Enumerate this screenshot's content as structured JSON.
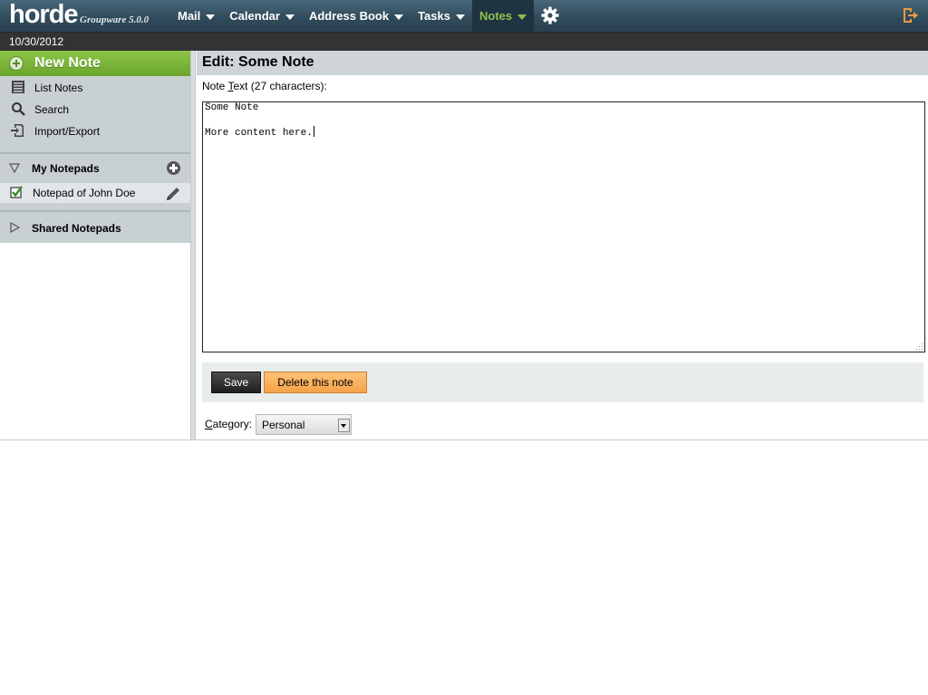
{
  "header": {
    "logo_text": "horde",
    "logo_sub": "Groupware 5.0.0",
    "menu": [
      {
        "label": "Mail",
        "active": false
      },
      {
        "label": "Calendar",
        "active": false
      },
      {
        "label": "Address Book",
        "active": false
      },
      {
        "label": "Tasks",
        "active": false
      },
      {
        "label": "Notes",
        "active": true
      }
    ],
    "accent_color": "#8bc34a"
  },
  "date": "10/30/2012",
  "sidebar": {
    "new_note": "New Note",
    "nav": [
      {
        "label": "List Notes",
        "icon": "list-notes-icon"
      },
      {
        "label": "Search",
        "icon": "search-icon"
      },
      {
        "label": "Import/Export",
        "icon": "import-export-icon"
      }
    ],
    "my_notepads": {
      "title": "My Notepads",
      "items": [
        {
          "label": "Notepad of John Doe",
          "checked": true
        }
      ]
    },
    "shared_notepads": {
      "title": "Shared Notepads"
    }
  },
  "main": {
    "heading": "Edit: Some Note",
    "note_label_prefix": "Note ",
    "note_label_key": "T",
    "note_label_suffix": "ext (27 characters):",
    "note_lines": [
      "Some Note",
      "More content here."
    ],
    "save_label": "Save",
    "delete_label": "Delete this note",
    "category_label_key": "C",
    "category_label_rest": "ategory:",
    "category_value": "Personal"
  }
}
